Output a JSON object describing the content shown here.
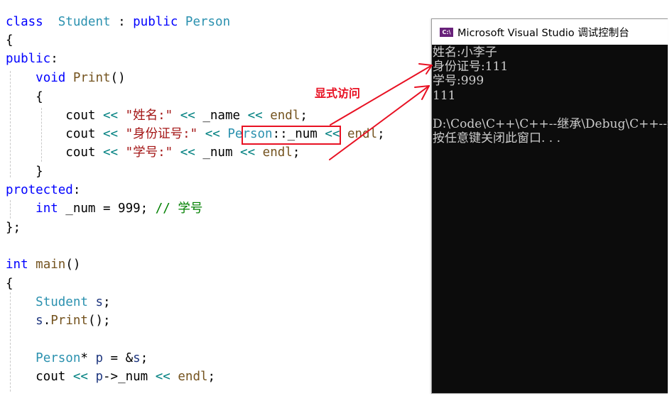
{
  "editor": {
    "language": "C++",
    "lines": [
      {
        "tokens": [
          [
            "kw",
            "class"
          ],
          [
            "",
            "  "
          ],
          [
            "ty",
            "Student"
          ],
          [
            "",
            " : "
          ],
          [
            "kw",
            "public"
          ],
          [
            "",
            " "
          ],
          [
            "ty",
            "Person"
          ]
        ]
      },
      {
        "tokens": [
          [
            "",
            "{"
          ]
        ]
      },
      {
        "tokens": [
          [
            "kw",
            "public"
          ],
          [
            "",
            ":"
          ]
        ]
      },
      {
        "tokens": [
          [
            "",
            "    "
          ],
          [
            "kw",
            "void"
          ],
          [
            "",
            " "
          ],
          [
            "fn",
            "Print"
          ],
          [
            "",
            "()"
          ]
        ]
      },
      {
        "tokens": [
          [
            "",
            "    {"
          ]
        ]
      },
      {
        "tokens": [
          [
            "",
            "        cout "
          ],
          [
            "op",
            "<<"
          ],
          [
            "",
            " "
          ],
          [
            "st",
            "\"姓名:\""
          ],
          [
            "",
            " "
          ],
          [
            "op",
            "<<"
          ],
          [
            "",
            " _name "
          ],
          [
            "op",
            "<<"
          ],
          [
            "",
            " "
          ],
          [
            "fn",
            "endl"
          ],
          [
            "",
            ";"
          ]
        ]
      },
      {
        "tokens": [
          [
            "",
            "        cout "
          ],
          [
            "op",
            "<<"
          ],
          [
            "",
            " "
          ],
          [
            "st",
            "\"身份证号:\""
          ],
          [
            "",
            " "
          ],
          [
            "op",
            "<<"
          ],
          [
            "",
            " "
          ],
          [
            "ty",
            "Person"
          ],
          [
            "",
            "::_num "
          ],
          [
            "op",
            "<<"
          ],
          [
            "",
            " "
          ],
          [
            "fn",
            "endl"
          ],
          [
            "",
            ";"
          ]
        ]
      },
      {
        "tokens": [
          [
            "",
            "        cout "
          ],
          [
            "op",
            "<<"
          ],
          [
            "",
            " "
          ],
          [
            "st",
            "\"学号:\""
          ],
          [
            "",
            " "
          ],
          [
            "op",
            "<<"
          ],
          [
            "",
            " _num "
          ],
          [
            "op",
            "<<"
          ],
          [
            "",
            " "
          ],
          [
            "fn",
            "endl"
          ],
          [
            "",
            ";"
          ]
        ]
      },
      {
        "tokens": [
          [
            "",
            "    }"
          ]
        ]
      },
      {
        "tokens": [
          [
            "kw",
            "protected"
          ],
          [
            "",
            ":"
          ]
        ]
      },
      {
        "tokens": [
          [
            "",
            "    "
          ],
          [
            "kw",
            "int"
          ],
          [
            "",
            " _num = 999; "
          ],
          [
            "cm",
            "// 学号"
          ]
        ]
      },
      {
        "tokens": [
          [
            "",
            "};"
          ]
        ]
      },
      {
        "tokens": [
          [
            "",
            ""
          ]
        ]
      },
      {
        "tokens": [
          [
            "kw",
            "int"
          ],
          [
            "",
            " "
          ],
          [
            "fn",
            "main"
          ],
          [
            "",
            "()"
          ]
        ]
      },
      {
        "tokens": [
          [
            "",
            "{"
          ]
        ]
      },
      {
        "tokens": [
          [
            "",
            "    "
          ],
          [
            "ty",
            "Student"
          ],
          [
            "",
            " "
          ],
          [
            "vr",
            "s"
          ],
          [
            "",
            ";"
          ]
        ]
      },
      {
        "tokens": [
          [
            "",
            "    "
          ],
          [
            "vr",
            "s"
          ],
          [
            "",
            "."
          ],
          [
            "fn",
            "Print"
          ],
          [
            "",
            "();"
          ]
        ]
      },
      {
        "tokens": [
          [
            "",
            ""
          ]
        ]
      },
      {
        "tokens": [
          [
            "",
            "    "
          ],
          [
            "ty",
            "Person"
          ],
          [
            "",
            "* "
          ],
          [
            "vr",
            "p"
          ],
          [
            "",
            " = &"
          ],
          [
            "vr",
            "s"
          ],
          [
            "",
            ";"
          ]
        ]
      },
      {
        "tokens": [
          [
            "",
            "    cout "
          ],
          [
            "op",
            "<<"
          ],
          [
            "",
            " "
          ],
          [
            "vr",
            "p"
          ],
          [
            "",
            "->_num "
          ],
          [
            "op",
            "<<"
          ],
          [
            "",
            " "
          ],
          [
            "fn",
            "endl"
          ],
          [
            "",
            ";"
          ]
        ]
      }
    ]
  },
  "annotation": {
    "label": "显式访问",
    "highlighted_code": "Person::_num",
    "color": "#e81123"
  },
  "console": {
    "title": "Microsoft Visual Studio 调试控制台",
    "icon_label": "C:\\",
    "output_lines": [
      "姓名:小李子",
      "身份证号:111",
      "学号:999",
      "111",
      "",
      "D:\\Code\\C++\\C++--继承\\Debug\\C++--继承.exe",
      "按任意键关闭此窗口. . ."
    ]
  },
  "colors": {
    "keyword": "#0000ff",
    "type": "#2b91af",
    "function": "#74531f",
    "string": "#a31515",
    "operator": "#008080",
    "comment": "#008000",
    "console_bg": "#0c0c0c",
    "console_fg": "#cccccc"
  }
}
